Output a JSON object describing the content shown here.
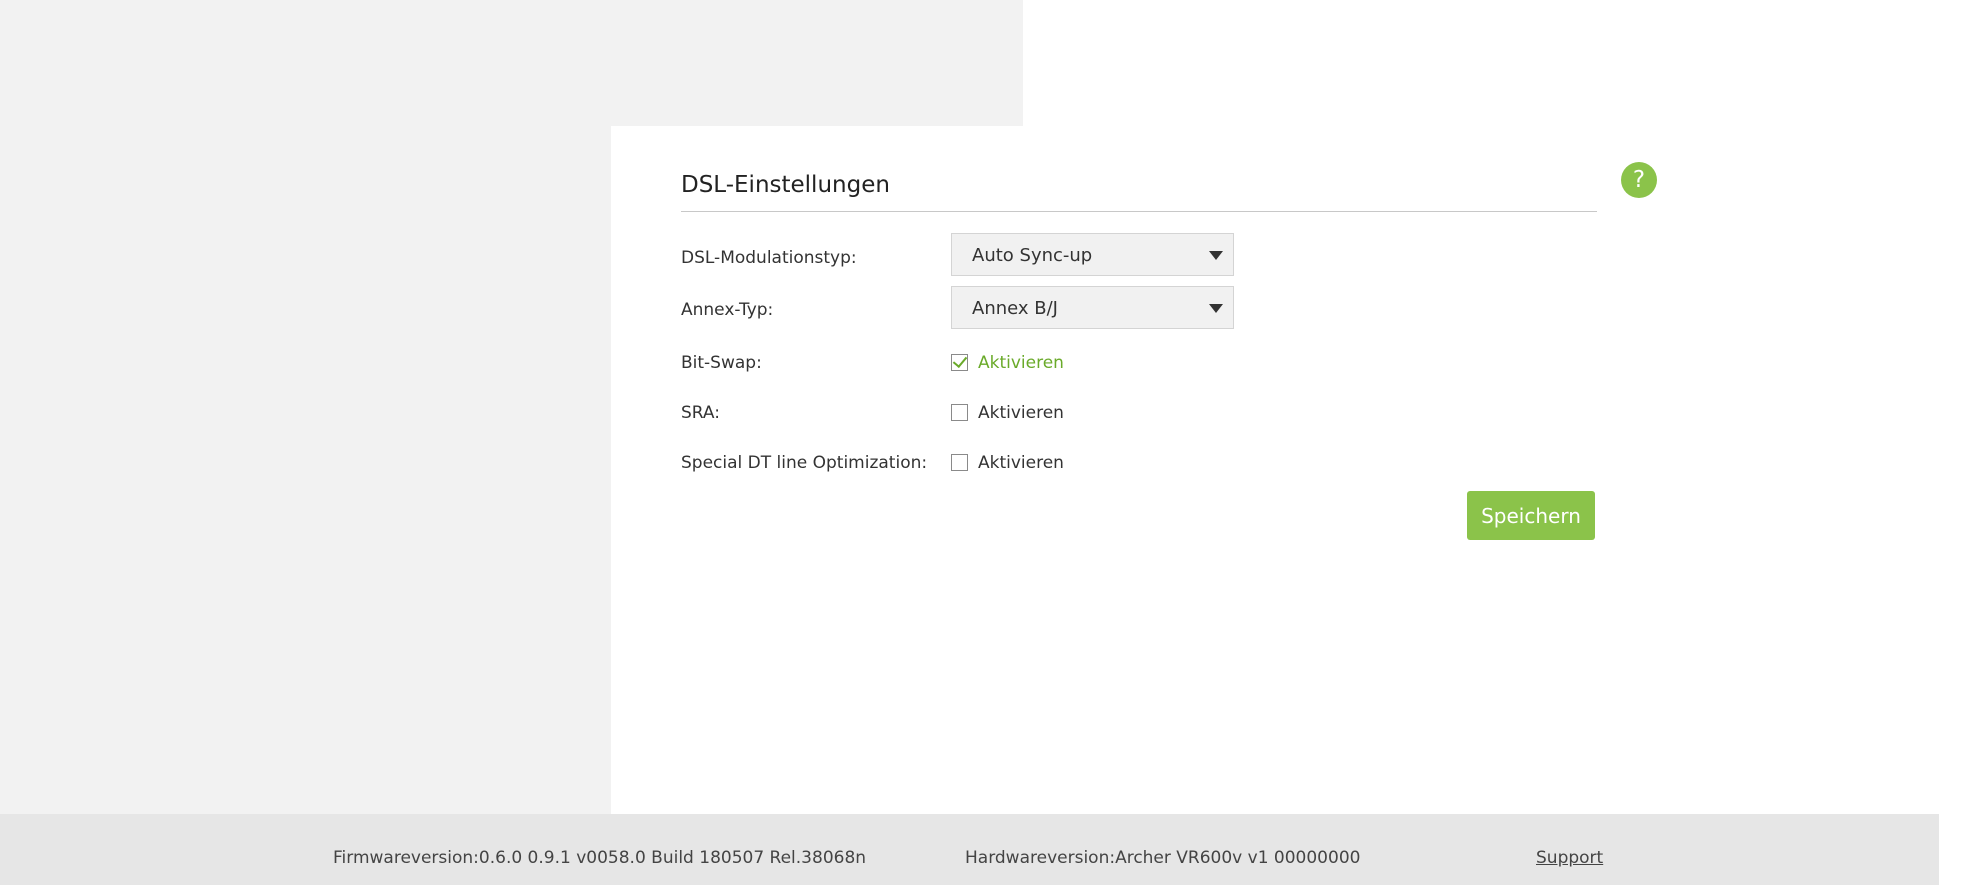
{
  "section": {
    "title": "DSL-Einstellungen",
    "help_icon": "question-mark-icon"
  },
  "form": {
    "modulation": {
      "label": "DSL-Modulationstyp:",
      "value": "Auto Sync-up"
    },
    "annex": {
      "label": "Annex-Typ:",
      "value": "Annex B/J"
    },
    "bitswap": {
      "label": "Bit-Swap:",
      "checkbox_label": "Aktivieren",
      "checked": true
    },
    "sra": {
      "label": "SRA:",
      "checkbox_label": "Aktivieren",
      "checked": false
    },
    "dt_opt": {
      "label": "Special DT line Optimization:",
      "checkbox_label": "Aktivieren",
      "checked": false
    },
    "save_label": "Speichern"
  },
  "footer": {
    "firmware": "Firmwareversion:0.6.0 0.9.1 v0058.0 Build 180507 Rel.38068n",
    "hardware": "Hardwareversion:Archer VR600v v1 00000000",
    "support": "Support"
  },
  "colors": {
    "accent": "#8bc34a",
    "check_green": "#6aaa2a",
    "background_gray": "#f2f2f2",
    "footer_gray": "#e6e6e6"
  }
}
